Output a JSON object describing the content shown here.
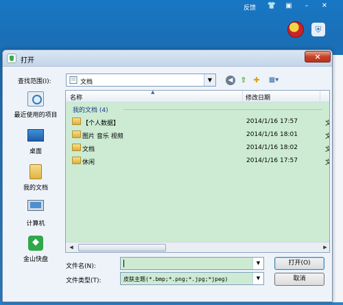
{
  "background": {
    "topbar": {
      "feedback": "反馈"
    }
  },
  "dialog": {
    "title": "打开",
    "close": "×",
    "look_in": {
      "label": "查找范围(I):",
      "value": "文档"
    },
    "places": [
      {
        "label": "最近使用的项目",
        "icon": "recent-items-icon"
      },
      {
        "label": "桌面",
        "icon": "desktop-icon"
      },
      {
        "label": "我的文档",
        "icon": "my-documents-icon"
      },
      {
        "label": "计算机",
        "icon": "computer-icon"
      },
      {
        "label": "金山快盘",
        "icon": "kingsoft-kuaipan-icon"
      }
    ],
    "columns": {
      "name": "名称",
      "modified": "修改日期"
    },
    "group": "我的文档 (4)",
    "files": [
      {
        "name": "【个人数据】",
        "date": "2014/1/16 17:57",
        "extra": "文"
      },
      {
        "name": "图片 音乐 视频",
        "date": "2014/1/16 18:01",
        "extra": "文"
      },
      {
        "name": "文档",
        "date": "2014/1/16 18:02",
        "extra": "文"
      },
      {
        "name": "休闲",
        "date": "2014/1/16 17:57",
        "extra": "文"
      }
    ],
    "filename": {
      "label": "文件名(N):",
      "value": ""
    },
    "filetype": {
      "label": "文件类型(T):",
      "value": "皮肤主题(*.bmp;*.png;*.jpg;*jpeg)"
    },
    "buttons": {
      "open": "打开(O)",
      "cancel": "取消"
    }
  },
  "colors": {
    "list_bg": "#ccebd2",
    "titlebar": "#c4d5ea",
    "app_bg": "#1a6fb6"
  }
}
